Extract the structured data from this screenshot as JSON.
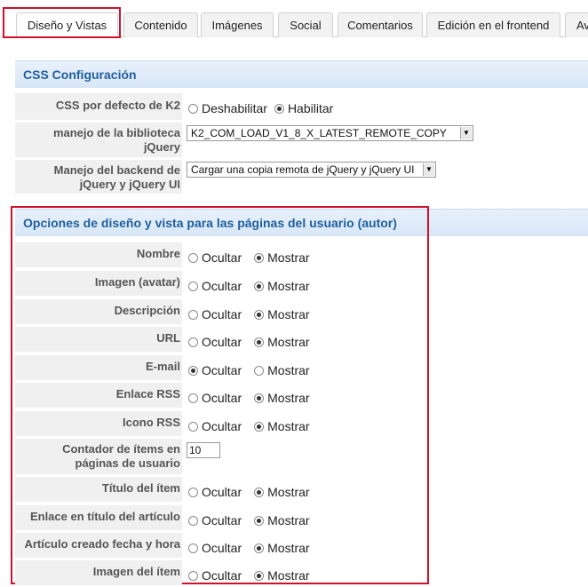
{
  "tabs": [
    {
      "label": "Diseño y Vistas"
    },
    {
      "label": "Contenido"
    },
    {
      "label": "Imágenes"
    },
    {
      "label": "Social"
    },
    {
      "label": "Comentarios"
    },
    {
      "label": "Edición en el frontend"
    },
    {
      "label": "Av"
    }
  ],
  "css_section": {
    "title": "CSS Configuración",
    "rows": [
      {
        "label": "CSS por defecto de K2",
        "options": [
          "Deshabilitar",
          "Habilitar"
        ],
        "selected": "Habilitar"
      },
      {
        "label": "manejo de la biblioteca jQuery",
        "select_value": "K2_COM_LOAD_V1_8_X_LATEST_REMOTE_COPY"
      },
      {
        "label": "Manejo del backend de jQuery y jQuery UI",
        "select_value": "Cargar una copia remota de jQuery y jQuery UI"
      }
    ]
  },
  "user_section": {
    "title": "Opciones de diseño y vista para las páginas del usuario (autor)",
    "option_hide": "Ocultar",
    "option_show": "Mostrar",
    "rows": [
      {
        "label": "Nombre",
        "selected": "Mostrar"
      },
      {
        "label": "Imagen (avatar)",
        "selected": "Mostrar"
      },
      {
        "label": "Descripción",
        "selected": "Mostrar"
      },
      {
        "label": "URL",
        "selected": "Mostrar"
      },
      {
        "label": "E-mail",
        "selected": "Ocultar"
      },
      {
        "label": "Enlace RSS",
        "selected": "Mostrar"
      },
      {
        "label": "Icono RSS",
        "selected": "Mostrar"
      },
      {
        "label": "Contador de ítems en páginas de usuario",
        "input_value": "10"
      },
      {
        "label": "Título del ítem",
        "selected": "Mostrar"
      },
      {
        "label": "Enlace en título del artículo",
        "selected": "Mostrar"
      },
      {
        "label": "Artículo creado fecha y hora",
        "selected": "Mostrar"
      },
      {
        "label": "Imagen del ítem",
        "selected": "Mostrar"
      }
    ]
  },
  "colors": {
    "highlight": "#d0112b",
    "section_title": "#1f5f9e"
  }
}
